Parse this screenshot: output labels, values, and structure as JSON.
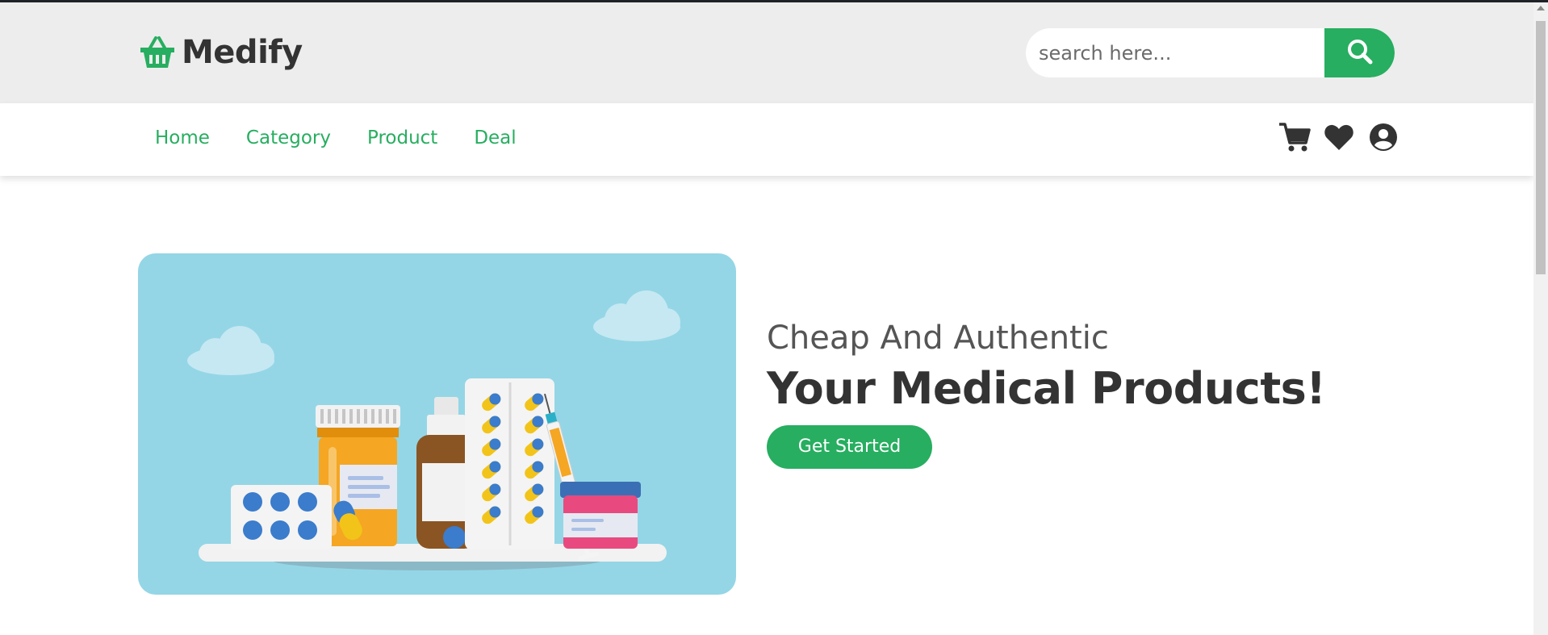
{
  "header": {
    "logo_text": "Medify",
    "logo_icon": "basket-icon",
    "search": {
      "placeholder": "search here...",
      "value": "",
      "button_icon": "search-icon"
    }
  },
  "nav": {
    "links": [
      "Home",
      "Category",
      "Product",
      "Deal"
    ],
    "icons": [
      "cart-icon",
      "heart-icon",
      "user-icon"
    ]
  },
  "hero": {
    "subtitle": "Cheap And Authentic",
    "title": "Your Medical Products!",
    "cta_label": "Get Started"
  },
  "colors": {
    "accent": "#27ae60",
    "header_bg": "#ededed",
    "hero_image_bg": "#94d6e6",
    "text_dark": "#333333"
  }
}
